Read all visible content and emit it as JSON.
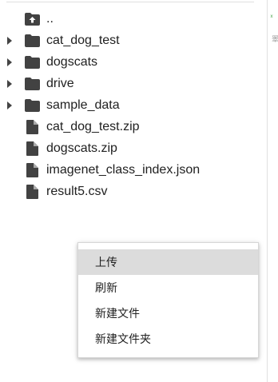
{
  "file_browser": {
    "parent_dir": {
      "label": "..",
      "icon": "folder-up-icon"
    },
    "items": [
      {
        "label": "cat_dog_test",
        "type": "folder",
        "icon": "folder-icon",
        "expandable": true
      },
      {
        "label": "dogscats",
        "type": "folder",
        "icon": "folder-icon",
        "expandable": true
      },
      {
        "label": "drive",
        "type": "folder",
        "icon": "folder-icon",
        "expandable": true
      },
      {
        "label": "sample_data",
        "type": "folder",
        "icon": "folder-icon",
        "expandable": true
      },
      {
        "label": "cat_dog_test.zip",
        "type": "file",
        "icon": "file-icon",
        "expandable": false
      },
      {
        "label": "dogscats.zip",
        "type": "file",
        "icon": "file-icon",
        "expandable": false
      },
      {
        "label": "imagenet_class_index.json",
        "type": "file",
        "icon": "file-icon",
        "expandable": false
      },
      {
        "label": "result5.csv",
        "type": "file",
        "icon": "file-icon",
        "expandable": false
      }
    ]
  },
  "context_menu": {
    "items": [
      {
        "label": "上传",
        "highlighted": true
      },
      {
        "label": "刷新",
        "highlighted": false
      },
      {
        "label": "新建文件",
        "highlighted": false
      },
      {
        "label": "新建文件夹",
        "highlighted": false
      }
    ]
  },
  "right_panel": {
    "glyph_1": "ͯ",
    "glyph_2": "睪"
  },
  "colors": {
    "icon": "#424242",
    "menu_highlight": "#dcdcdc",
    "divider": "#e0e0e0",
    "accent_green": "#43a047"
  }
}
